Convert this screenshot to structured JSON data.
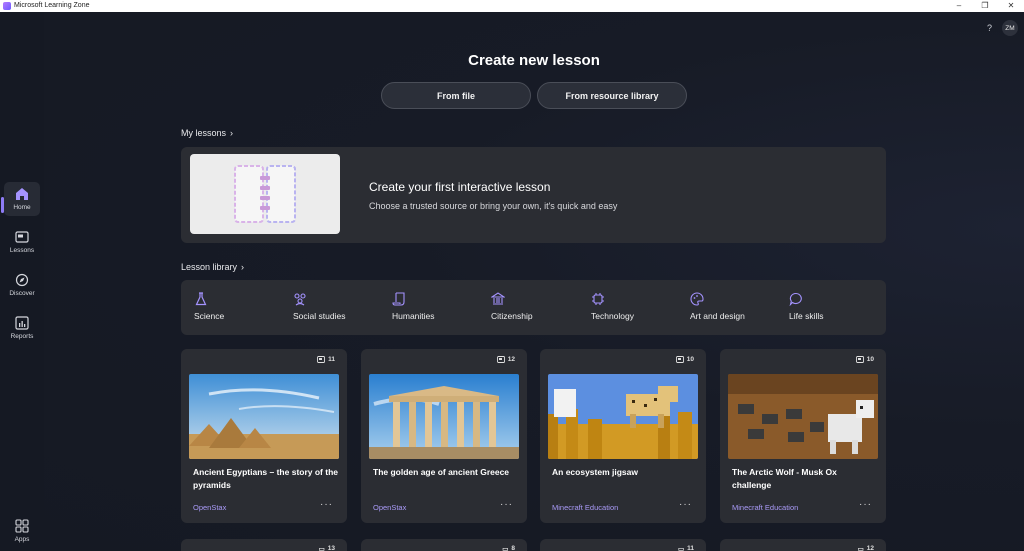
{
  "window": {
    "title": "Microsoft Learning Zone",
    "minimize": "–",
    "maximize": "❐",
    "close": "✕"
  },
  "topbar": {
    "help": "?",
    "avatar_initials": "ZM"
  },
  "sidebar": {
    "items": [
      {
        "label": "Home",
        "icon": "home-icon",
        "active": true
      },
      {
        "label": "Lessons",
        "icon": "lessons-icon",
        "active": false
      },
      {
        "label": "Discover",
        "icon": "discover-icon",
        "active": false
      },
      {
        "label": "Reports",
        "icon": "reports-icon",
        "active": false
      }
    ],
    "apps_label": "Apps"
  },
  "main": {
    "title": "Create new lesson",
    "from_file": "From file",
    "from_library": "From resource library",
    "my_lessons_label": "My lessons",
    "my_lessons_card": {
      "title": "Create your first interactive lesson",
      "subtitle": "Choose a trusted source or bring your own, it's quick and easy"
    },
    "library_label": "Lesson library",
    "categories": [
      {
        "label": "Science",
        "icon": "flask-icon"
      },
      {
        "label": "Social studies",
        "icon": "people-icon"
      },
      {
        "label": "Humanities",
        "icon": "scroll-icon"
      },
      {
        "label": "Citizenship",
        "icon": "building-icon"
      },
      {
        "label": "Technology",
        "icon": "chip-icon"
      },
      {
        "label": "Art and design",
        "icon": "palette-icon"
      },
      {
        "label": "Life skills",
        "icon": "chat-icon"
      }
    ],
    "lessons": [
      {
        "count": "11",
        "title": "Ancient Egyptians – the story of the pyramids",
        "source": "OpenStax",
        "more": "···"
      },
      {
        "count": "12",
        "title": "The golden age of ancient Greece",
        "source": "OpenStax",
        "more": "···"
      },
      {
        "count": "10",
        "title": "An ecosystem jigsaw",
        "source": "Minecraft Education",
        "more": "···"
      },
      {
        "count": "10",
        "title": "The Arctic Wolf - Musk Ox challenge",
        "source": "Minecraft Education",
        "more": "···"
      }
    ],
    "peek_counts": [
      "13",
      "8",
      "11",
      "12"
    ]
  },
  "colors": {
    "accent": "#8e7cf6",
    "source_link": "#a99af7",
    "card_bg": "#2b2d33",
    "page_bg": "#151923"
  }
}
